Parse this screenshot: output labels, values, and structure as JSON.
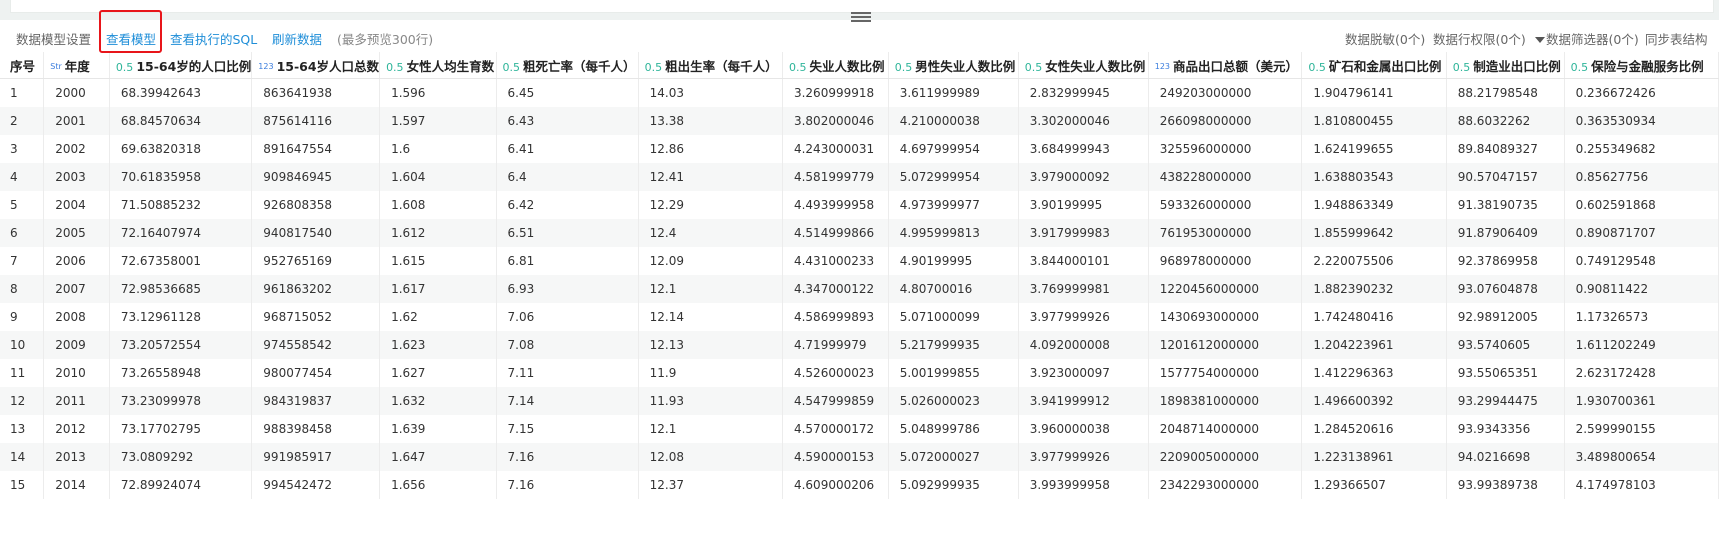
{
  "toolbar": {
    "settings_label": "数据模型设置",
    "view_model_label": "查看模型",
    "view_sql_label": "查看执行的SQL",
    "refresh_label": "刷新数据",
    "preview_note": "(最多预览300行)",
    "masking_label": "数据脱敏(0个)",
    "row_permission_label": "数据行权限(0个)",
    "filter_label": "数据筛选器(0个)",
    "sync_label": "同步表结构"
  },
  "table": {
    "columns": [
      {
        "tag": "",
        "label": "序号"
      },
      {
        "tag": "Str",
        "label": "年度"
      },
      {
        "tag": "0.5",
        "label": "15-64岁的人口比例"
      },
      {
        "tag": "123",
        "label": "15-64岁人口总数"
      },
      {
        "tag": "0.5",
        "label": "女性人均生育数"
      },
      {
        "tag": "0.5",
        "label": "粗死亡率（每千人）"
      },
      {
        "tag": "0.5",
        "label": "粗出生率（每千人）"
      },
      {
        "tag": "0.5",
        "label": "失业人数比例"
      },
      {
        "tag": "0.5",
        "label": "男性失业人数比例"
      },
      {
        "tag": "0.5",
        "label": "女性失业人数比例"
      },
      {
        "tag": "123",
        "label": "商品出口总额（美元）"
      },
      {
        "tag": "0.5",
        "label": "矿石和金属出口比例"
      },
      {
        "tag": "0.5",
        "label": "制造业出口比例"
      },
      {
        "tag": "0.5",
        "label": "保险与金融服务比例"
      }
    ],
    "rows": [
      [
        "1",
        "2000",
        "68.39942643",
        "863641938",
        "1.596",
        "6.45",
        "14.03",
        "3.260999918",
        "3.611999989",
        "2.832999945",
        "249203000000",
        "1.904796141",
        "88.21798548",
        "0.236672426"
      ],
      [
        "2",
        "2001",
        "68.84570634",
        "875614116",
        "1.597",
        "6.43",
        "13.38",
        "3.802000046",
        "4.210000038",
        "3.302000046",
        "266098000000",
        "1.810800455",
        "88.6032262",
        "0.363530934"
      ],
      [
        "3",
        "2002",
        "69.63820318",
        "891647554",
        "1.6",
        "6.41",
        "12.86",
        "4.243000031",
        "4.697999954",
        "3.684999943",
        "325596000000",
        "1.624199655",
        "89.84089327",
        "0.255349682"
      ],
      [
        "4",
        "2003",
        "70.61835958",
        "909846945",
        "1.604",
        "6.4",
        "12.41",
        "4.581999779",
        "5.072999954",
        "3.979000092",
        "438228000000",
        "1.638803543",
        "90.57047157",
        "0.85627756"
      ],
      [
        "5",
        "2004",
        "71.50885232",
        "926808358",
        "1.608",
        "6.42",
        "12.29",
        "4.493999958",
        "4.973999977",
        "3.90199995",
        "593326000000",
        "1.948863349",
        "91.38190735",
        "0.602591868"
      ],
      [
        "6",
        "2005",
        "72.16407974",
        "940817540",
        "1.612",
        "6.51",
        "12.4",
        "4.514999866",
        "4.995999813",
        "3.917999983",
        "761953000000",
        "1.855999642",
        "91.87906409",
        "0.890871707"
      ],
      [
        "7",
        "2006",
        "72.67358001",
        "952765169",
        "1.615",
        "6.81",
        "12.09",
        "4.431000233",
        "4.90199995",
        "3.844000101",
        "968978000000",
        "2.220075506",
        "92.37869958",
        "0.749129548"
      ],
      [
        "8",
        "2007",
        "72.98536685",
        "961863202",
        "1.617",
        "6.93",
        "12.1",
        "4.347000122",
        "4.80700016",
        "3.769999981",
        "1220456000000",
        "1.882390232",
        "93.07604878",
        "0.90811422"
      ],
      [
        "9",
        "2008",
        "73.12961128",
        "968715052",
        "1.62",
        "7.06",
        "12.14",
        "4.586999893",
        "5.071000099",
        "3.977999926",
        "1430693000000",
        "1.742480416",
        "92.98912005",
        "1.17326573"
      ],
      [
        "10",
        "2009",
        "73.20572554",
        "974558542",
        "1.623",
        "7.08",
        "12.13",
        "4.71999979",
        "5.217999935",
        "4.092000008",
        "1201612000000",
        "1.204223961",
        "93.5740605",
        "1.611202249"
      ],
      [
        "11",
        "2010",
        "73.26558948",
        "980077454",
        "1.627",
        "7.11",
        "11.9",
        "4.526000023",
        "5.001999855",
        "3.923000097",
        "1577754000000",
        "1.412296363",
        "93.55065351",
        "2.623172428"
      ],
      [
        "12",
        "2011",
        "73.23099978",
        "984319837",
        "1.632",
        "7.14",
        "11.93",
        "4.547999859",
        "5.026000023",
        "3.941999912",
        "1898381000000",
        "1.496600392",
        "93.29944475",
        "1.930700361"
      ],
      [
        "13",
        "2012",
        "73.17702795",
        "988398458",
        "1.639",
        "7.15",
        "12.1",
        "4.570000172",
        "5.048999786",
        "3.960000038",
        "2048714000000",
        "1.284520616",
        "93.9343356",
        "2.599990155"
      ],
      [
        "14",
        "2013",
        "73.0809292",
        "991985917",
        "1.647",
        "7.16",
        "12.08",
        "4.590000153",
        "5.072000027",
        "3.977999926",
        "2209005000000",
        "1.223138961",
        "94.0216698",
        "3.489800654"
      ],
      [
        "15",
        "2014",
        "72.89924074",
        "994542472",
        "1.656",
        "7.16",
        "12.37",
        "4.609000206",
        "5.092999935",
        "3.993999958",
        "2342293000000",
        "1.29366507",
        "93.99389738",
        "4.174978103"
      ]
    ]
  }
}
